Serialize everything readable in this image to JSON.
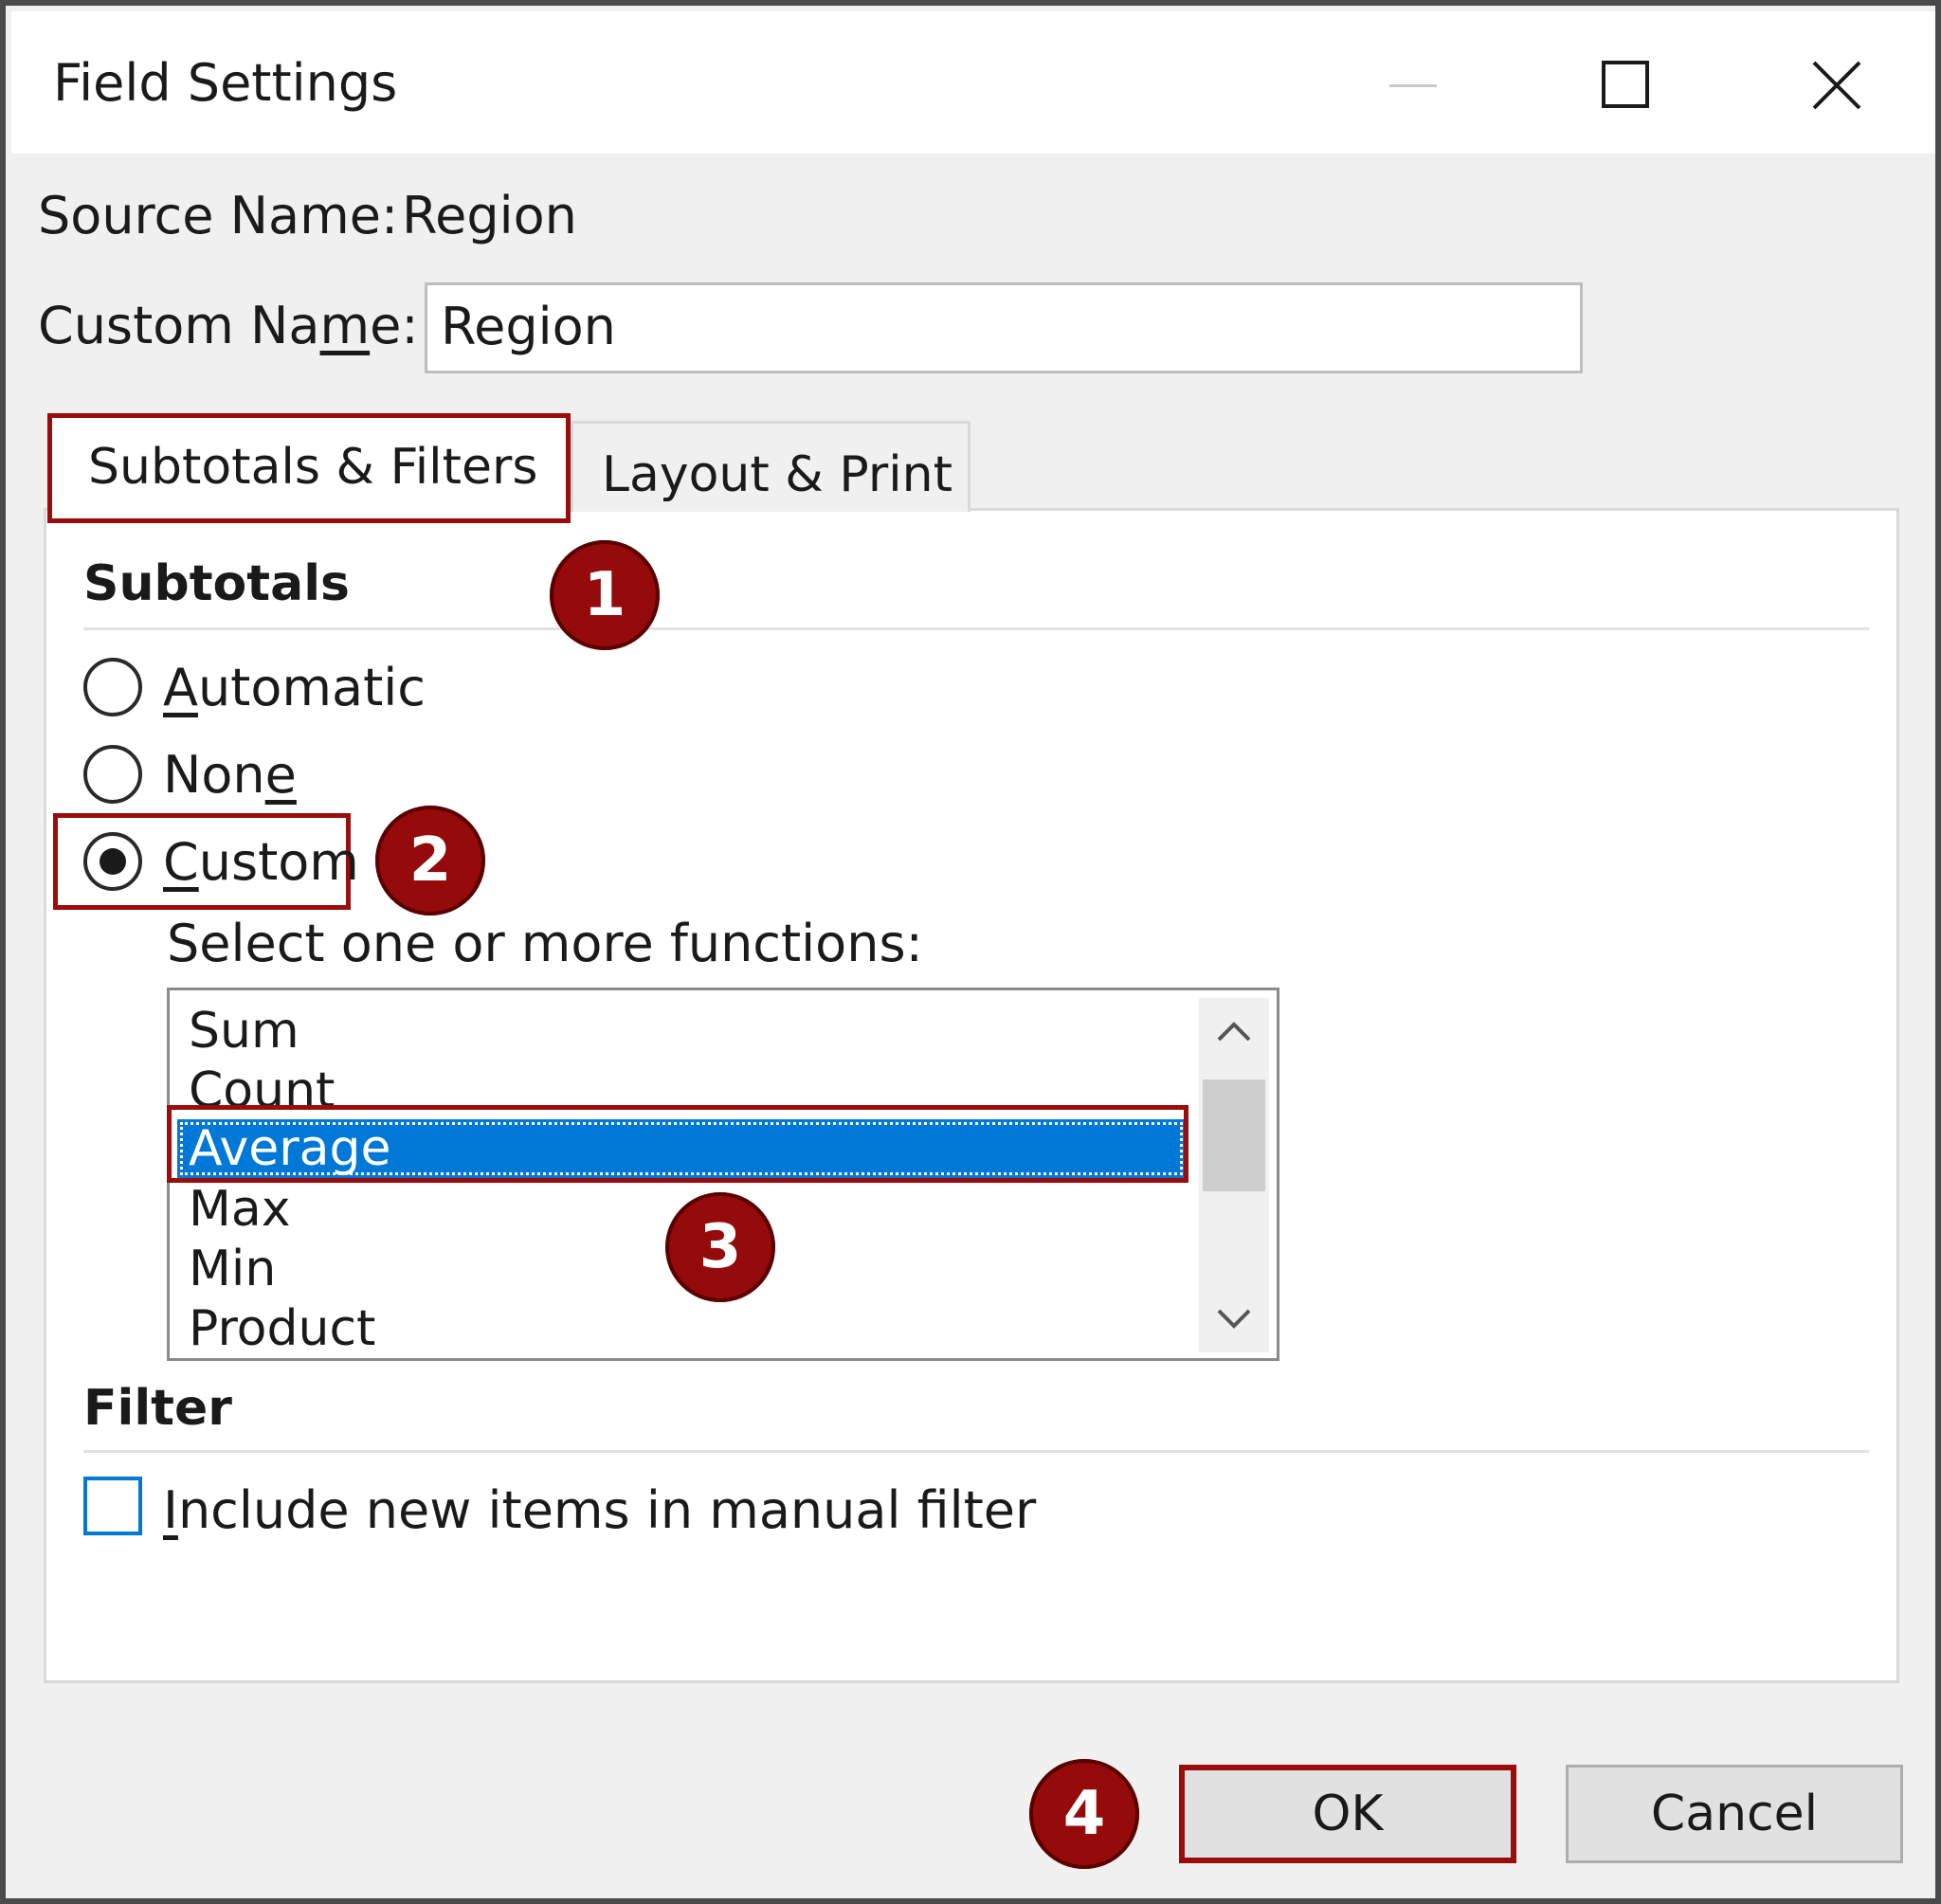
{
  "window": {
    "title": "Field Settings",
    "minimize_icon": "minimize-icon",
    "maximize_icon": "maximize-icon",
    "close_icon": "close-icon"
  },
  "source_name": {
    "label": "Source Name:",
    "value": "Region"
  },
  "custom_name": {
    "label_pre": "Custom Na",
    "label_u": "m",
    "label_post": "e:",
    "value": "Region"
  },
  "tabs": [
    {
      "label": "Subtotals & Filters",
      "active": true
    },
    {
      "label": "Layout & Print",
      "active": false
    }
  ],
  "subtotals": {
    "title": "Subtotals",
    "options": [
      {
        "u": "A",
        "rest": "utomatic",
        "selected": false
      },
      {
        "pre": "Non",
        "u": "e",
        "selected": false
      },
      {
        "u": "C",
        "rest": "ustom",
        "selected": true
      }
    ],
    "functions_label": "Select one or more functions:",
    "functions": [
      "Sum",
      "Count",
      "Average",
      "Max",
      "Min",
      "Product"
    ],
    "selected_function": "Average"
  },
  "filter": {
    "title": "Filter",
    "checkbox_u": "I",
    "checkbox_rest": "nclude new items in manual filter",
    "checked": false
  },
  "buttons": {
    "ok": "OK",
    "cancel": "Cancel"
  },
  "annotations": [
    "1",
    "2",
    "3",
    "4"
  ],
  "colors": {
    "accent_red": "#9b0d0d",
    "badge": "#950a0a",
    "selection": "#0078d7"
  }
}
